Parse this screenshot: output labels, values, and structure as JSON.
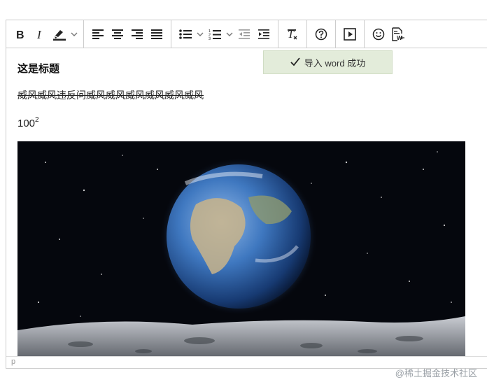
{
  "toolbar": {
    "icons": [
      "bold-icon",
      "italic-icon",
      "highlight-icon",
      "align-left-icon",
      "align-center-icon",
      "align-right-icon",
      "align-justify-icon",
      "bullet-list-icon",
      "numbered-list-icon",
      "outdent-icon",
      "indent-icon",
      "clear-format-icon",
      "help-icon",
      "media-icon",
      "emoji-icon",
      "import-word-icon"
    ]
  },
  "content": {
    "heading": "这是标题",
    "strike_text": "威风威风违反问威风威风威风威风威风威风",
    "number_base": "100",
    "number_exp": "2",
    "image_name": "earth-image"
  },
  "statusbar": {
    "path": "p"
  },
  "toast": {
    "message": "导入 word 成功"
  },
  "watermark": "@稀土掘金技术社区",
  "colors": {
    "toast_bg": "#e3ecda",
    "border": "#cccccc"
  }
}
